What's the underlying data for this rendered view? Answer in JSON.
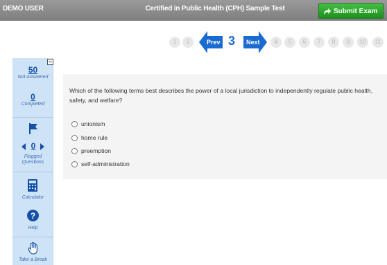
{
  "header": {
    "user": "DEMO USER",
    "title": "Certified in Public Health (CPH) Sample Test",
    "submit_label": "Submit Exam",
    "submit_icon": "share-arrow-icon"
  },
  "pagination": {
    "pages_before": [
      "1",
      "2"
    ],
    "prev_label": "Prev",
    "current": "3",
    "next_label": "Next",
    "pages_after": [
      "4",
      "5",
      "6",
      "7",
      "8",
      "9",
      "10",
      "11"
    ]
  },
  "sidebar": {
    "not_answered_count": "50",
    "not_answered_label": "Not Answered",
    "completed_count": "0",
    "completed_label": "Completed",
    "flagged_count": "0",
    "flagged_label_1": "Flagged",
    "flagged_label_2": "Questions",
    "calculator_label": "Calculator",
    "help_label": "Help",
    "break_label": "Take a Break"
  },
  "question": {
    "text": "Which of the following terms best describes the power of a local jurisdiction to independently regulate public health, safety, and welfare?",
    "options": [
      "unionism",
      "home rule",
      "preemption",
      "self-administration"
    ]
  },
  "colors": {
    "accent_blue": "#1a6bd1",
    "submit_green": "#2aa52a",
    "sidebar_bg": "#cfe3f7"
  }
}
